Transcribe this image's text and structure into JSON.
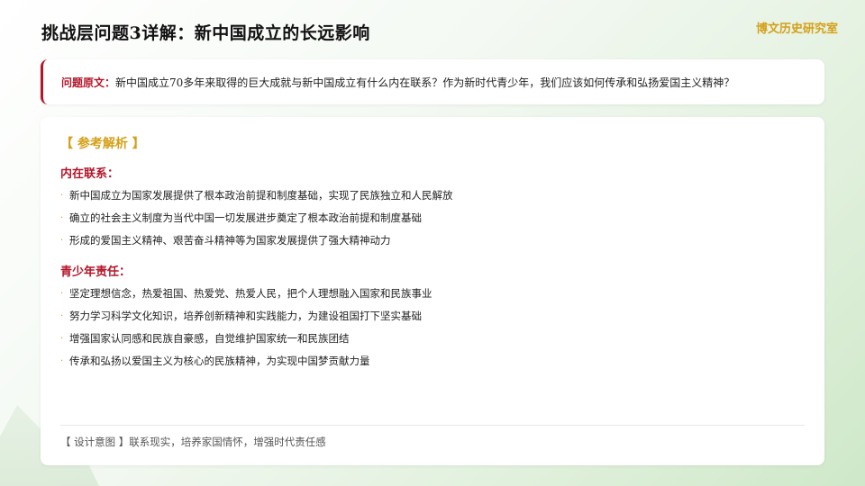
{
  "header": {
    "title": "挑战层问题3详解：新中国成立的长远影响",
    "brand": "博文历史研究室"
  },
  "question": {
    "label": "问题原文：",
    "text": "新中国成立70多年来取得的巨大成就与新中国成立有什么内在联系？作为新时代青少年，我们应该如何传承和弘扬爱国主义精神？"
  },
  "analysis": {
    "section_title": "【 参考解析 】",
    "sections": [
      {
        "heading": "内在联系：",
        "items": [
          "新中国成立为国家发展提供了根本政治前提和制度基础，实现了民族独立和人民解放",
          "确立的社会主义制度为当代中国一切发展进步奠定了根本政治前提和制度基础",
          "形成的爱国主义精神、艰苦奋斗精神等为国家发展提供了强大精神动力"
        ]
      },
      {
        "heading": "青少年责任：",
        "items": [
          "坚定理想信念，热爱祖国、热爱党、热爱人民，把个人理想融入国家和民族事业",
          "努力学习科学文化知识，培养创新精神和实践能力，为建设祖国打下坚实基础",
          "增强国家认同感和民族自豪感，自觉维护国家统一和民族团结",
          "传承和弘扬以爱国主义为核心的民族精神，为实现中国梦贡献力量"
        ]
      }
    ],
    "design_note": "【 设计意图 】联系现实，培养家国情怀，增强时代责任感"
  },
  "icons": {
    "bullet": "small-dot-bullet"
  },
  "colors": {
    "accent_red": "#b3162a",
    "accent_gold": "#d4a017",
    "background_green": "#cfe8c9"
  }
}
